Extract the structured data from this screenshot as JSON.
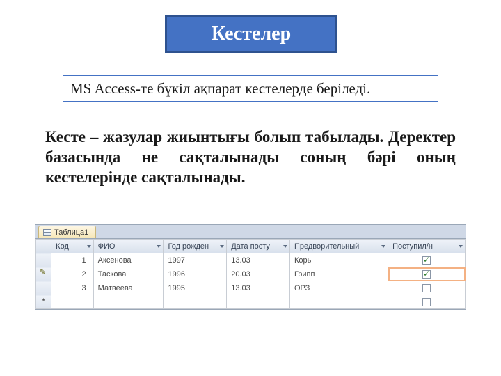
{
  "title": "Кестелер",
  "subtitle": "MS Access-те бүкіл ақпарат  кестелерде беріледі.",
  "description": "Кесте – жазулар жиынтығы болып табылады. Деректер базасында не сақталынады соның бәрі оның кестелерінде сақталынады.",
  "access": {
    "tab_label": "Таблица1",
    "columns": {
      "id": "Код",
      "fio": "ФИО",
      "year": "Год рожден",
      "date": "Дата посту",
      "diag": "Предворительный",
      "enr": "Поступил/н"
    },
    "rows": [
      {
        "id": "1",
        "fio": "Аксенова",
        "year": "1997",
        "date": "13.03",
        "diag": "Корь",
        "enr_checked": true,
        "editing": false
      },
      {
        "id": "2",
        "fio": "Таскова",
        "year": "1996",
        "date": "20.03",
        "diag": "Грипп",
        "enr_checked": true,
        "editing": true
      },
      {
        "id": "3",
        "fio": "Матвеева",
        "year": "1995",
        "date": "13.03",
        "diag": "ОРЗ",
        "enr_checked": false,
        "editing": false
      }
    ]
  }
}
